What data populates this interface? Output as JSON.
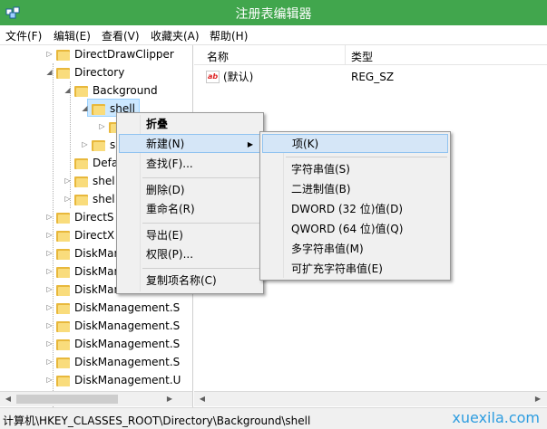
{
  "window": {
    "title": "注册表编辑器",
    "titlebar_color": "#41a64d"
  },
  "menubar": [
    "文件(F)",
    "编辑(E)",
    "查看(V)",
    "收藏夹(A)",
    "帮助(H)"
  ],
  "tree": [
    {
      "label": "DirectDrawClipper",
      "expander": "right"
    },
    {
      "label": "Directory",
      "expander": "down"
    },
    {
      "label": "Background",
      "expander": "down"
    },
    {
      "label": "shell",
      "expander": "down",
      "selected": true
    },
    {
      "label": "",
      "expander": "right"
    },
    {
      "label": "s",
      "expander": "right"
    },
    {
      "label": "Defa",
      "expander": "none"
    },
    {
      "label": "shel",
      "expander": "right"
    },
    {
      "label": "shel",
      "expander": "right"
    },
    {
      "label": "DirectS",
      "expander": "right"
    },
    {
      "label": "DirectX",
      "expander": "right"
    },
    {
      "label": "DiskMan",
      "expander": "right"
    },
    {
      "label": "DiskMan",
      "expander": "right"
    },
    {
      "label": "DiskMan",
      "expander": "right"
    },
    {
      "label": "DiskManagement.S",
      "expander": "right"
    },
    {
      "label": "DiskManagement.S",
      "expander": "right"
    },
    {
      "label": "DiskManagement.S",
      "expander": "right"
    },
    {
      "label": "DiskManagement.S",
      "expander": "right"
    },
    {
      "label": "DiskManagement.U",
      "expander": "right"
    }
  ],
  "list": {
    "columns": [
      "名称",
      "类型"
    ],
    "rows": [
      {
        "icon": "ab",
        "name": "(默认)",
        "type": "REG_SZ"
      }
    ]
  },
  "context_menu": {
    "items": [
      "折叠",
      "新建(N)",
      "查找(F)...",
      "删除(D)",
      "重命名(R)",
      "导出(E)",
      "权限(P)...",
      "复制项名称(C)"
    ],
    "highlighted": "新建(N)"
  },
  "submenu": {
    "items": [
      "项(K)",
      "字符串值(S)",
      "二进制值(B)",
      "DWORD (32 位)值(D)",
      "QWORD (64 位)值(Q)",
      "多字符串值(M)",
      "可扩充字符串值(E)"
    ],
    "highlighted": "项(K)"
  },
  "statusbar": {
    "path": "计算机\\HKEY_CLASSES_ROOT\\Directory\\Background\\shell"
  },
  "watermark": "xuexila.com",
  "accent": "#41a64d"
}
